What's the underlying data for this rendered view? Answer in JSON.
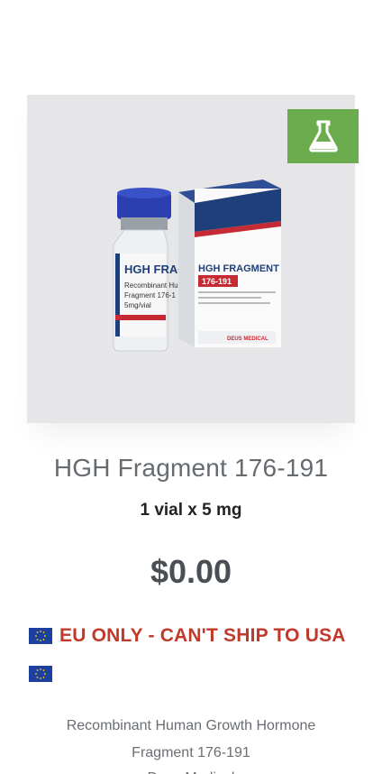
{
  "product": {
    "title": "HGH Fragment 176-191",
    "variant": "1 vial x 5 mg",
    "price": "$0.00",
    "notice": "EU ONLY - CAN'T SHIP TO USA",
    "description_line1": "Recombinant Human Growth Hormone",
    "description_line2": "Fragment 176-191",
    "description_line3": "Deus Medical"
  },
  "vial_label": {
    "name": "HGH FRAG",
    "line1": "Recombinant Hu",
    "line2": "Fragment 176-1",
    "line3": "5mg/vial"
  },
  "box_label": {
    "name": "HGH FRAGMENT",
    "code": "176-191",
    "brand": "DEUS MEDICAL"
  },
  "colors": {
    "badge": "#6aac4e",
    "notice": "#c0392b",
    "box_navy": "#1f3f7a",
    "box_red": "#c62b33"
  },
  "icons": {
    "badge_icon": "flask-icon",
    "flag_icon": "eu-flag-icon"
  }
}
